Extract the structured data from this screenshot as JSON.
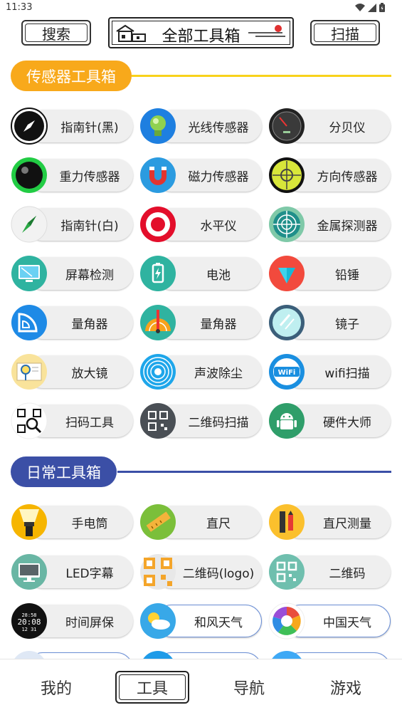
{
  "status_bar": {
    "time": "11:33",
    "icons": [
      "wifi-icon",
      "signal-icon",
      "battery-icon"
    ]
  },
  "top_bar": {
    "search_label": "搜索",
    "title": "全部工具箱",
    "scan_label": "扫描"
  },
  "sections": [
    {
      "title": "传感器工具箱",
      "color": "#f8a91b",
      "items": [
        {
          "label": "指南针(黑)",
          "icon": "compass-black-icon"
        },
        {
          "label": "光线传感器",
          "icon": "light-sensor-icon"
        },
        {
          "label": "分贝仪",
          "icon": "decibel-meter-icon"
        },
        {
          "label": "重力传感器",
          "icon": "gravity-sensor-icon"
        },
        {
          "label": "磁力传感器",
          "icon": "magnet-icon"
        },
        {
          "label": "方向传感器",
          "icon": "direction-sensor-icon"
        },
        {
          "label": "指南针(白)",
          "icon": "compass-white-icon"
        },
        {
          "label": "水平仪",
          "icon": "level-target-icon"
        },
        {
          "label": "金属探测器",
          "icon": "metal-detector-icon"
        },
        {
          "label": "屏幕检测",
          "icon": "screen-check-icon"
        },
        {
          "label": "电池",
          "icon": "battery-icon"
        },
        {
          "label": "铅锤",
          "icon": "plumb-bob-icon"
        },
        {
          "label": "量角器",
          "icon": "protractor-icon"
        },
        {
          "label": "量角器",
          "icon": "protractor-2-icon"
        },
        {
          "label": "镜子",
          "icon": "mirror-icon"
        },
        {
          "label": "放大镜",
          "icon": "magnifier-icon"
        },
        {
          "label": "声波除尘",
          "icon": "sound-wave-icon"
        },
        {
          "label": "wifi扫描",
          "icon": "wifi-scan-icon"
        },
        {
          "label": "扫码工具",
          "icon": "qr-scan-icon"
        },
        {
          "label": "二维码扫描",
          "icon": "qr-code-scan-icon"
        },
        {
          "label": "硬件大师",
          "icon": "android-icon"
        }
      ]
    },
    {
      "title": "日常工具箱",
      "color": "#3b4fa6",
      "items": [
        {
          "label": "手电筒",
          "icon": "flashlight-icon"
        },
        {
          "label": "直尺",
          "icon": "ruler-icon"
        },
        {
          "label": "直尺测量",
          "icon": "ruler-measure-icon"
        },
        {
          "label": "LED字幕",
          "icon": "led-screen-icon"
        },
        {
          "label": "二维码(logo)",
          "icon": "qr-logo-icon"
        },
        {
          "label": "二维码",
          "icon": "qr-code-icon"
        },
        {
          "label": "时间屏保",
          "icon": "clock-screensaver-icon"
        },
        {
          "label": "和风天气",
          "icon": "weather-sun-cloud-icon"
        },
        {
          "label": "中国天气",
          "icon": "china-weather-icon"
        }
      ]
    }
  ],
  "bottom_nav": {
    "items": [
      {
        "label": "我的",
        "active": false
      },
      {
        "label": "工具",
        "active": true
      },
      {
        "label": "导航",
        "active": false
      },
      {
        "label": "游戏",
        "active": false
      }
    ]
  }
}
